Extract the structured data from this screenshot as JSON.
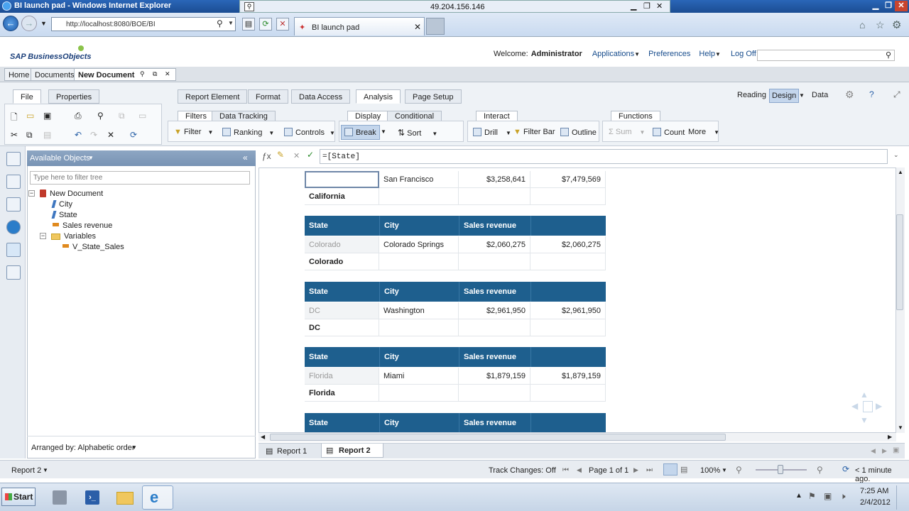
{
  "window": {
    "title": "BI launch pad - Windows Internet Explorer"
  },
  "remote": {
    "ip": "49.204.156.146"
  },
  "browser": {
    "url": "http://localhost:8080/BOE/BI",
    "tab_title": "BI launch pad"
  },
  "app": {
    "logo": "SAP BusinessObjects",
    "welcome_label": "Welcome:",
    "user": "Administrator",
    "nav": [
      "Applications",
      "Preferences",
      "Help",
      "Log Off"
    ]
  },
  "doc_tabs": [
    "Home",
    "Documents",
    "New Document"
  ],
  "ribbon": {
    "left_tabs": [
      "File",
      "Properties"
    ],
    "main_tabs": [
      "Report Element",
      "Format",
      "Data Access",
      "Analysis",
      "Page Setup"
    ],
    "modes": [
      "Reading",
      "Design",
      "Data"
    ],
    "groups": {
      "filters": {
        "tabs": [
          "Filters",
          "Data Tracking"
        ],
        "items": [
          "Filter",
          "Ranking",
          "Controls"
        ]
      },
      "display": {
        "tabs": [
          "Display",
          "Conditional"
        ],
        "items": [
          "Break",
          "Sort"
        ]
      },
      "interact": {
        "tab": "Interact",
        "items": [
          "Drill",
          "Filter Bar",
          "Outline"
        ]
      },
      "functions": {
        "tab": "Functions",
        "items": [
          "Sum",
          "Count",
          "More"
        ]
      }
    }
  },
  "objects_panel": {
    "title": "Available Objects",
    "filter_placeholder": "Type here to filter tree",
    "tree": [
      "New Document",
      "City",
      "State",
      "Sales revenue",
      "Variables",
      "V_State_Sales"
    ],
    "arranged_by": "Arranged by: Alphabetic order"
  },
  "formula": "=[State]",
  "report": {
    "headers": [
      "State",
      "City",
      "Sales revenue"
    ],
    "partial_row": {
      "city": "San Francisco",
      "revenue": "$3,258,641",
      "total": "$7,479,569",
      "footer": "California"
    },
    "blocks": [
      {
        "state": "Colorado",
        "city": "Colorado Springs",
        "revenue": "$2,060,275",
        "total": "$2,060,275",
        "footer": "Colorado"
      },
      {
        "state": "DC",
        "city": "Washington",
        "revenue": "$2,961,950",
        "total": "$2,961,950",
        "footer": "DC"
      },
      {
        "state": "Florida",
        "city": "Miami",
        "revenue": "$1,879,159",
        "total": "$1,879,159",
        "footer": "Florida"
      }
    ]
  },
  "report_tabs": [
    "Report 1",
    "Report 2"
  ],
  "status": {
    "current_report": "Report 2",
    "track_changes": "Track Changes: Off",
    "page": "Page 1 of 1",
    "zoom": "100%",
    "refreshed": "< 1 minute ago."
  },
  "taskbar": {
    "start": "Start",
    "time": "7:25 AM",
    "date": "2/4/2012"
  },
  "colors": {
    "header_blue": "#1e5f8e",
    "ie_title": "#1b4d92"
  }
}
